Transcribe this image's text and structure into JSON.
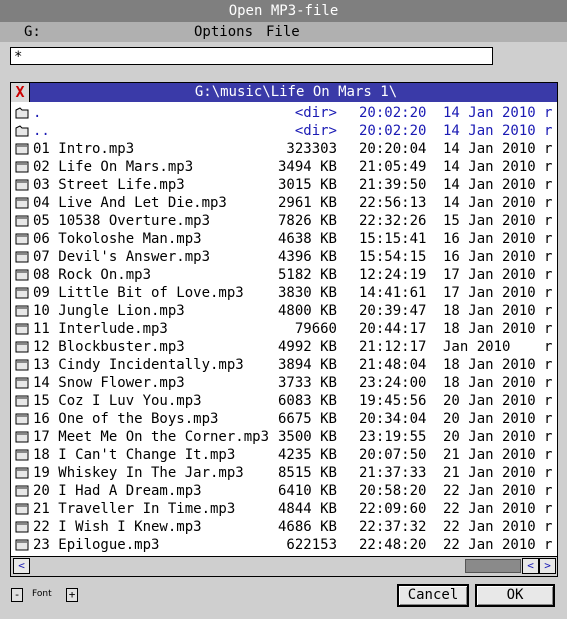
{
  "window": {
    "title": "Open MP3-file"
  },
  "menu": {
    "drive": "G:",
    "options": "Options",
    "file": "File"
  },
  "path_input": {
    "value": "*________________________________________________"
  },
  "list": {
    "path": "G:\\music\\Life On Mars 1\\",
    "close_label": "X",
    "rows": [
      {
        "type": "dir",
        "name": ".",
        "size": "<dir>",
        "time": "20:02:20",
        "date": "14 Jan 2010",
        "attr": "r"
      },
      {
        "type": "dir",
        "name": "..",
        "size": "<dir>",
        "time": "20:02:20",
        "date": "14 Jan 2010",
        "attr": "r"
      },
      {
        "type": "file",
        "name": "01 Intro.mp3",
        "size": "323303",
        "time": "20:20:04",
        "date": "14 Jan 2010",
        "attr": "r"
      },
      {
        "type": "file",
        "name": "02 Life On Mars.mp3",
        "size": "3494 KB",
        "time": "21:05:49",
        "date": "14 Jan 2010",
        "attr": "r"
      },
      {
        "type": "file",
        "name": "03 Street Life.mp3",
        "size": "3015 KB",
        "time": "21:39:50",
        "date": "14 Jan 2010",
        "attr": "r"
      },
      {
        "type": "file",
        "name": "04 Live And Let Die.mp3",
        "size": "2961 KB",
        "time": "22:56:13",
        "date": "14 Jan 2010",
        "attr": "r"
      },
      {
        "type": "file",
        "name": "05 10538 Overture.mp3",
        "size": "7826 KB",
        "time": "22:32:26",
        "date": "15 Jan 2010",
        "attr": "r"
      },
      {
        "type": "file",
        "name": "06 Tokoloshe Man.mp3",
        "size": "4638 KB",
        "time": "15:15:41",
        "date": "16 Jan 2010",
        "attr": "r"
      },
      {
        "type": "file",
        "name": "07 Devil's Answer.mp3",
        "size": "4396 KB",
        "time": "15:54:15",
        "date": "16 Jan 2010",
        "attr": "r"
      },
      {
        "type": "file",
        "name": "08 Rock On.mp3",
        "size": "5182 KB",
        "time": "12:24:19",
        "date": "17 Jan 2010",
        "attr": "r"
      },
      {
        "type": "file",
        "name": "09 Little Bit of Love.mp3",
        "size": "3830 KB",
        "time": "14:41:61",
        "date": "17 Jan 2010",
        "attr": "r"
      },
      {
        "type": "file",
        "name": "10 Jungle Lion.mp3",
        "size": "4800 KB",
        "time": "20:39:47",
        "date": "18 Jan 2010",
        "attr": "r"
      },
      {
        "type": "file",
        "name": "11 Interlude.mp3",
        "size": "79660",
        "time": "20:44:17",
        "date": "18 Jan 2010",
        "attr": "r"
      },
      {
        "type": "file",
        "name": "12 Blockbuster.mp3",
        "size": "4992 KB",
        "time": "21:12:17",
        "date": "Jan 2010",
        "attr": "r"
      },
      {
        "type": "file",
        "name": "13 Cindy Incidentally.mp3",
        "size": "3894 KB",
        "time": "21:48:04",
        "date": "18 Jan 2010",
        "attr": "r"
      },
      {
        "type": "file",
        "name": "14 Snow Flower.mp3",
        "size": "3733 KB",
        "time": "23:24:00",
        "date": "18 Jan 2010",
        "attr": "r"
      },
      {
        "type": "file",
        "name": "15 Coz I Luv You.mp3",
        "size": "6083 KB",
        "time": "19:45:56",
        "date": "20 Jan 2010",
        "attr": "r"
      },
      {
        "type": "file",
        "name": "16 One of the Boys.mp3",
        "size": "6675 KB",
        "time": "20:34:04",
        "date": "20 Jan 2010",
        "attr": "r"
      },
      {
        "type": "file",
        "name": "17 Meet Me On the Corner.mp3",
        "size": "3500 KB",
        "time": "23:19:55",
        "date": "20 Jan 2010",
        "attr": "r"
      },
      {
        "type": "file",
        "name": "18 I Can't Change It.mp3",
        "size": "4235 KB",
        "time": "20:07:50",
        "date": "21 Jan 2010",
        "attr": "r"
      },
      {
        "type": "file",
        "name": "19 Whiskey In The Jar.mp3",
        "size": "8515 KB",
        "time": "21:37:33",
        "date": "21 Jan 2010",
        "attr": "r"
      },
      {
        "type": "file",
        "name": "20 I Had A Dream.mp3",
        "size": "6410 KB",
        "time": "20:58:20",
        "date": "22 Jan 2010",
        "attr": "r"
      },
      {
        "type": "file",
        "name": "21 Traveller In Time.mp3",
        "size": "4844 KB",
        "time": "22:09:60",
        "date": "22 Jan 2010",
        "attr": "r"
      },
      {
        "type": "file",
        "name": "22 I Wish I Knew.mp3",
        "size": "4686 KB",
        "time": "22:37:32",
        "date": "22 Jan 2010",
        "attr": "r"
      },
      {
        "type": "file",
        "name": "23 Epilogue.mp3",
        "size": "622153",
        "time": "22:48:20",
        "date": "22 Jan 2010",
        "attr": "r"
      }
    ]
  },
  "scrollbar": {
    "left_arrow": "<",
    "right_arrow": ">",
    "left_arrow_icon": "arrow-left-icon",
    "right_arrow_icon": "arrow-right-icon"
  },
  "font_control": {
    "minus": "-",
    "label": "Font",
    "plus": "+"
  },
  "buttons": {
    "cancel": "Cancel",
    "ok": "OK"
  },
  "colors": {
    "title_bar": "#7f7f7f",
    "list_header": "#3a3aa8",
    "dir_text": "#1a1ab4",
    "close_x": "#cc0000"
  }
}
